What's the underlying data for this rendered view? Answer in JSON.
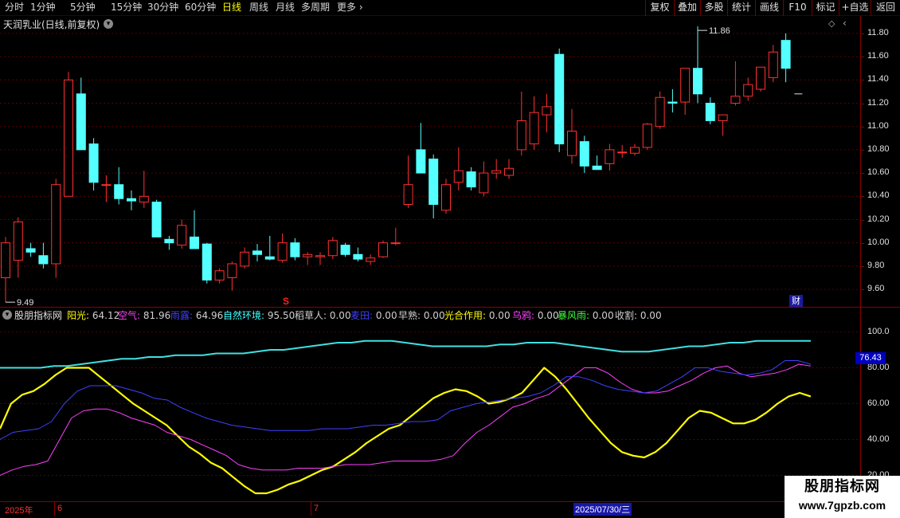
{
  "toolbar": {
    "periods": [
      "分时",
      "1分钟",
      "5分钟",
      "15分钟",
      "30分钟",
      "60分钟",
      "日线",
      "周线",
      "月线",
      "多周期",
      "更多"
    ],
    "more_arrow": "›",
    "active_period": "日线",
    "buttons": [
      "复权",
      "叠加",
      "多股",
      "统计",
      "画线",
      "F10",
      "标记",
      "+自选",
      "返回"
    ]
  },
  "main_panel": {
    "title": "天润乳业(日线,前复权)",
    "y_ticks": [
      "11.80",
      "11.60",
      "11.40",
      "11.20",
      "11.00",
      "10.80",
      "10.60",
      "10.40",
      "10.20",
      "10.00",
      "9.80",
      "9.60"
    ],
    "high_label": "11.86",
    "low_label": "9.49",
    "signal_mark": "S",
    "badge": "财"
  },
  "indicator_panel": {
    "name": "股朋指标网",
    "legend": [
      {
        "label": "阳光:",
        "value": "64.12",
        "color": "#ffff00"
      },
      {
        "label": "空气:",
        "value": "81.96",
        "color": "#ff40ff"
      },
      {
        "label": "雨露:",
        "value": "64.96",
        "color": "#4040ff"
      },
      {
        "label": "自然环境:",
        "value": "95.50",
        "color": "#40ffff"
      },
      {
        "label": "稻草人:",
        "value": "0.00",
        "color": "#d0d0d0"
      },
      {
        "label": "麦田:",
        "value": "0.00",
        "color": "#4040ff"
      },
      {
        "label": "早熟:",
        "value": "0.00",
        "color": "#d0d0d0"
      },
      {
        "label": "光合作用:",
        "value": "0.00",
        "color": "#ffff00"
      },
      {
        "label": "乌鸦:",
        "value": "0.00",
        "color": "#ff40ff"
      },
      {
        "label": "暴风雨:",
        "value": "0.00",
        "color": "#40ff40"
      },
      {
        "label": "收割:",
        "value": "0.00",
        "color": "#d0d0d0"
      }
    ],
    "y_ticks": [
      "100.0",
      "80.00",
      "60.00",
      "40.00",
      "20.00"
    ],
    "current_value": "76.43"
  },
  "time_axis": {
    "labels": [
      "2025年",
      "6",
      "7"
    ],
    "cursor_date": "2025/07/30/三"
  },
  "watermark": {
    "line1": "股朋指标网",
    "line2": "www.7gpzb.com"
  },
  "colors": {
    "up": "#ff3030",
    "down": "#54ffff",
    "sunshine": "#ffff00",
    "air": "#ff40ff",
    "dew": "#4040ff",
    "environment": "#40e0e0"
  },
  "chart_data": {
    "type": "candlestick",
    "ylim": [
      9.45,
      11.95
    ],
    "candles": [
      {
        "o": 9.7,
        "h": 10.05,
        "l": 9.49,
        "c": 10.0
      },
      {
        "o": 9.85,
        "h": 10.22,
        "l": 9.7,
        "c": 10.18
      },
      {
        "o": 9.95,
        "h": 10.0,
        "l": 9.88,
        "c": 9.92
      },
      {
        "o": 9.89,
        "h": 10.0,
        "l": 9.78,
        "c": 9.82
      },
      {
        "o": 9.82,
        "h": 10.55,
        "l": 9.7,
        "c": 10.5
      },
      {
        "o": 10.4,
        "h": 11.47,
        "l": 10.4,
        "c": 11.4
      },
      {
        "o": 11.28,
        "h": 11.42,
        "l": 10.85,
        "c": 10.8
      },
      {
        "o": 10.85,
        "h": 10.9,
        "l": 10.45,
        "c": 10.52
      },
      {
        "o": 10.5,
        "h": 10.58,
        "l": 10.35,
        "c": 10.5
      },
      {
        "o": 10.5,
        "h": 10.65,
        "l": 10.33,
        "c": 10.38
      },
      {
        "o": 10.38,
        "h": 10.45,
        "l": 10.28,
        "c": 10.36
      },
      {
        "o": 10.35,
        "h": 10.62,
        "l": 10.3,
        "c": 10.4
      },
      {
        "o": 10.35,
        "h": 10.37,
        "l": 10.05,
        "c": 10.05
      },
      {
        "o": 10.03,
        "h": 10.06,
        "l": 9.94,
        "c": 10.0
      },
      {
        "o": 9.98,
        "h": 10.2,
        "l": 9.95,
        "c": 10.15
      },
      {
        "o": 10.05,
        "h": 10.28,
        "l": 9.95,
        "c": 9.95
      },
      {
        "o": 9.99,
        "h": 10.0,
        "l": 9.65,
        "c": 9.68
      },
      {
        "o": 9.68,
        "h": 9.78,
        "l": 9.65,
        "c": 9.76
      },
      {
        "o": 9.7,
        "h": 9.84,
        "l": 9.59,
        "c": 9.82
      },
      {
        "o": 9.8,
        "h": 9.96,
        "l": 9.78,
        "c": 9.92
      },
      {
        "o": 9.93,
        "h": 9.99,
        "l": 9.84,
        "c": 9.9
      },
      {
        "o": 9.88,
        "h": 10.06,
        "l": 9.85,
        "c": 9.86
      },
      {
        "o": 9.85,
        "h": 10.08,
        "l": 9.83,
        "c": 10.0
      },
      {
        "o": 10.0,
        "h": 10.04,
        "l": 9.85,
        "c": 9.88
      },
      {
        "o": 9.88,
        "h": 9.92,
        "l": 9.81,
        "c": 9.9
      },
      {
        "o": 9.88,
        "h": 9.92,
        "l": 9.81,
        "c": 9.89
      },
      {
        "o": 9.89,
        "h": 10.05,
        "l": 9.86,
        "c": 10.02
      },
      {
        "o": 9.98,
        "h": 10.0,
        "l": 9.88,
        "c": 9.9
      },
      {
        "o": 9.9,
        "h": 9.96,
        "l": 9.84,
        "c": 9.86
      },
      {
        "o": 9.84,
        "h": 9.9,
        "l": 9.81,
        "c": 9.87
      },
      {
        "o": 9.88,
        "h": 10.02,
        "l": 9.87,
        "c": 10.0
      },
      {
        "o": 10.0,
        "h": 10.13,
        "l": 9.98,
        "c": 10.0
      },
      {
        "o": 10.33,
        "h": 10.75,
        "l": 10.3,
        "c": 10.5
      },
      {
        "o": 10.8,
        "h": 11.03,
        "l": 10.62,
        "c": 10.6
      },
      {
        "o": 10.72,
        "h": 10.76,
        "l": 10.21,
        "c": 10.33
      },
      {
        "o": 10.28,
        "h": 10.55,
        "l": 10.25,
        "c": 10.5
      },
      {
        "o": 10.52,
        "h": 10.82,
        "l": 10.45,
        "c": 10.62
      },
      {
        "o": 10.61,
        "h": 10.65,
        "l": 10.45,
        "c": 10.48
      },
      {
        "o": 10.43,
        "h": 10.7,
        "l": 10.4,
        "c": 10.6
      },
      {
        "o": 10.6,
        "h": 10.72,
        "l": 10.55,
        "c": 10.62
      },
      {
        "o": 10.58,
        "h": 10.72,
        "l": 10.55,
        "c": 10.64
      },
      {
        "o": 10.8,
        "h": 11.3,
        "l": 10.75,
        "c": 11.05
      },
      {
        "o": 10.85,
        "h": 11.26,
        "l": 10.8,
        "c": 11.12
      },
      {
        "o": 11.1,
        "h": 11.28,
        "l": 10.95,
        "c": 11.17
      },
      {
        "o": 11.62,
        "h": 11.67,
        "l": 10.78,
        "c": 10.85
      },
      {
        "o": 10.75,
        "h": 11.15,
        "l": 10.68,
        "c": 10.96
      },
      {
        "o": 10.87,
        "h": 10.92,
        "l": 10.6,
        "c": 10.66
      },
      {
        "o": 10.66,
        "h": 10.75,
        "l": 10.63,
        "c": 10.63
      },
      {
        "o": 10.68,
        "h": 10.85,
        "l": 10.62,
        "c": 10.8
      },
      {
        "o": 10.78,
        "h": 10.84,
        "l": 10.73,
        "c": 10.78
      },
      {
        "o": 10.77,
        "h": 10.85,
        "l": 10.75,
        "c": 10.82
      },
      {
        "o": 10.82,
        "h": 11.03,
        "l": 10.8,
        "c": 11.02
      },
      {
        "o": 11.0,
        "h": 11.3,
        "l": 10.98,
        "c": 11.25
      },
      {
        "o": 11.21,
        "h": 11.32,
        "l": 11.12,
        "c": 11.2
      },
      {
        "o": 11.21,
        "h": 11.5,
        "l": 11.1,
        "c": 11.5
      },
      {
        "o": 11.5,
        "h": 11.86,
        "l": 11.2,
        "c": 11.28
      },
      {
        "o": 11.2,
        "h": 11.25,
        "l": 11.02,
        "c": 11.05
      },
      {
        "o": 11.05,
        "h": 11.1,
        "l": 10.92,
        "c": 11.1
      },
      {
        "o": 11.2,
        "h": 11.56,
        "l": 11.18,
        "c": 11.26
      },
      {
        "o": 11.26,
        "h": 11.42,
        "l": 11.22,
        "c": 11.36
      },
      {
        "o": 11.32,
        "h": 11.51,
        "l": 11.3,
        "c": 11.51
      },
      {
        "o": 11.42,
        "h": 11.7,
        "l": 11.38,
        "c": 11.64
      },
      {
        "o": 11.74,
        "h": 11.8,
        "l": 11.38,
        "c": 11.5
      }
    ],
    "indicator": {
      "ylim": [
        10,
        110
      ],
      "series": [
        {
          "name": "阳光",
          "values": [
            46,
            60,
            65,
            67,
            71,
            76,
            80,
            80,
            80,
            75,
            70,
            65,
            60,
            56,
            52,
            48,
            42,
            36,
            32,
            27,
            24,
            19,
            14,
            10,
            10,
            12,
            15,
            17,
            20,
            23,
            25,
            29,
            33,
            38,
            42,
            46,
            48,
            53,
            58,
            63,
            66,
            68,
            67,
            64,
            60,
            61,
            63,
            66,
            73,
            80,
            75,
            68,
            60,
            52,
            45,
            38,
            33,
            31,
            30,
            33,
            38,
            45,
            52,
            56,
            55,
            52,
            49,
            49,
            51,
            55,
            60,
            64,
            66,
            64
          ]
        },
        {
          "name": "空气",
          "values": [
            20,
            23,
            25,
            26,
            28,
            40,
            52,
            56,
            57,
            57,
            55,
            52,
            50,
            48,
            44,
            42,
            40,
            37,
            34,
            31,
            26,
            24,
            23,
            23,
            23,
            24,
            24,
            24,
            25,
            26,
            26,
            26,
            27,
            28,
            28,
            28,
            28,
            29,
            31,
            38,
            44,
            48,
            53,
            58,
            60,
            63,
            65,
            70,
            75,
            80,
            80,
            77,
            72,
            68,
            66,
            66,
            67,
            70,
            73,
            77,
            80,
            81,
            77,
            75,
            76,
            77,
            79,
            82,
            81
          ]
        },
        {
          "name": "雨露",
          "values": [
            40,
            44,
            45,
            46,
            50,
            60,
            67,
            70,
            70,
            70,
            68,
            66,
            63,
            62,
            58,
            55,
            52,
            50,
            48,
            47,
            46,
            45,
            45,
            45,
            45,
            46,
            46,
            46,
            47,
            48,
            48,
            49,
            50,
            50,
            51,
            56,
            58,
            60,
            61,
            62,
            63,
            64,
            66,
            70,
            75,
            75,
            73,
            70,
            68,
            67,
            66,
            67,
            71,
            75,
            80,
            80,
            78,
            77,
            76,
            77,
            79,
            84,
            84,
            82
          ]
        },
        {
          "name": "自然环境",
          "values": [
            80,
            80,
            80,
            80,
            81,
            81,
            82,
            83,
            84,
            85,
            85,
            86,
            86,
            87,
            87,
            87,
            88,
            88,
            88,
            89,
            90,
            90,
            91,
            92,
            93,
            94,
            94,
            95,
            95,
            95,
            94,
            93,
            92,
            92,
            92,
            92,
            92,
            93,
            93,
            94,
            94,
            94,
            93,
            92,
            91,
            90,
            89,
            89,
            89,
            90,
            91,
            92,
            92,
            93,
            94,
            94,
            95,
            95,
            95,
            95,
            95
          ]
        }
      ]
    }
  }
}
